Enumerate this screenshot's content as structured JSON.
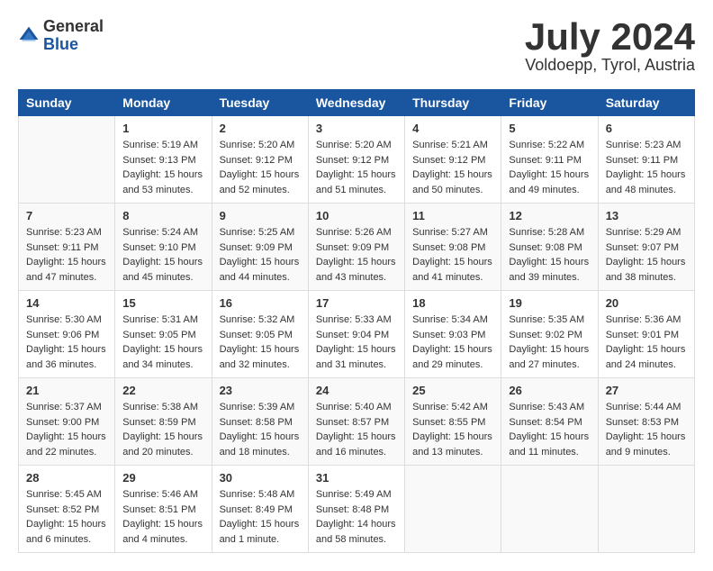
{
  "header": {
    "logo_general": "General",
    "logo_blue": "Blue",
    "month_title": "July 2024",
    "location": "Voldoepp, Tyrol, Austria"
  },
  "columns": [
    "Sunday",
    "Monday",
    "Tuesday",
    "Wednesday",
    "Thursday",
    "Friday",
    "Saturday"
  ],
  "weeks": [
    [
      {
        "day": "",
        "detail": ""
      },
      {
        "day": "1",
        "detail": "Sunrise: 5:19 AM\nSunset: 9:13 PM\nDaylight: 15 hours\nand 53 minutes."
      },
      {
        "day": "2",
        "detail": "Sunrise: 5:20 AM\nSunset: 9:12 PM\nDaylight: 15 hours\nand 52 minutes."
      },
      {
        "day": "3",
        "detail": "Sunrise: 5:20 AM\nSunset: 9:12 PM\nDaylight: 15 hours\nand 51 minutes."
      },
      {
        "day": "4",
        "detail": "Sunrise: 5:21 AM\nSunset: 9:12 PM\nDaylight: 15 hours\nand 50 minutes."
      },
      {
        "day": "5",
        "detail": "Sunrise: 5:22 AM\nSunset: 9:11 PM\nDaylight: 15 hours\nand 49 minutes."
      },
      {
        "day": "6",
        "detail": "Sunrise: 5:23 AM\nSunset: 9:11 PM\nDaylight: 15 hours\nand 48 minutes."
      }
    ],
    [
      {
        "day": "7",
        "detail": "Sunrise: 5:23 AM\nSunset: 9:11 PM\nDaylight: 15 hours\nand 47 minutes."
      },
      {
        "day": "8",
        "detail": "Sunrise: 5:24 AM\nSunset: 9:10 PM\nDaylight: 15 hours\nand 45 minutes."
      },
      {
        "day": "9",
        "detail": "Sunrise: 5:25 AM\nSunset: 9:09 PM\nDaylight: 15 hours\nand 44 minutes."
      },
      {
        "day": "10",
        "detail": "Sunrise: 5:26 AM\nSunset: 9:09 PM\nDaylight: 15 hours\nand 43 minutes."
      },
      {
        "day": "11",
        "detail": "Sunrise: 5:27 AM\nSunset: 9:08 PM\nDaylight: 15 hours\nand 41 minutes."
      },
      {
        "day": "12",
        "detail": "Sunrise: 5:28 AM\nSunset: 9:08 PM\nDaylight: 15 hours\nand 39 minutes."
      },
      {
        "day": "13",
        "detail": "Sunrise: 5:29 AM\nSunset: 9:07 PM\nDaylight: 15 hours\nand 38 minutes."
      }
    ],
    [
      {
        "day": "14",
        "detail": "Sunrise: 5:30 AM\nSunset: 9:06 PM\nDaylight: 15 hours\nand 36 minutes."
      },
      {
        "day": "15",
        "detail": "Sunrise: 5:31 AM\nSunset: 9:05 PM\nDaylight: 15 hours\nand 34 minutes."
      },
      {
        "day": "16",
        "detail": "Sunrise: 5:32 AM\nSunset: 9:05 PM\nDaylight: 15 hours\nand 32 minutes."
      },
      {
        "day": "17",
        "detail": "Sunrise: 5:33 AM\nSunset: 9:04 PM\nDaylight: 15 hours\nand 31 minutes."
      },
      {
        "day": "18",
        "detail": "Sunrise: 5:34 AM\nSunset: 9:03 PM\nDaylight: 15 hours\nand 29 minutes."
      },
      {
        "day": "19",
        "detail": "Sunrise: 5:35 AM\nSunset: 9:02 PM\nDaylight: 15 hours\nand 27 minutes."
      },
      {
        "day": "20",
        "detail": "Sunrise: 5:36 AM\nSunset: 9:01 PM\nDaylight: 15 hours\nand 24 minutes."
      }
    ],
    [
      {
        "day": "21",
        "detail": "Sunrise: 5:37 AM\nSunset: 9:00 PM\nDaylight: 15 hours\nand 22 minutes."
      },
      {
        "day": "22",
        "detail": "Sunrise: 5:38 AM\nSunset: 8:59 PM\nDaylight: 15 hours\nand 20 minutes."
      },
      {
        "day": "23",
        "detail": "Sunrise: 5:39 AM\nSunset: 8:58 PM\nDaylight: 15 hours\nand 18 minutes."
      },
      {
        "day": "24",
        "detail": "Sunrise: 5:40 AM\nSunset: 8:57 PM\nDaylight: 15 hours\nand 16 minutes."
      },
      {
        "day": "25",
        "detail": "Sunrise: 5:42 AM\nSunset: 8:55 PM\nDaylight: 15 hours\nand 13 minutes."
      },
      {
        "day": "26",
        "detail": "Sunrise: 5:43 AM\nSunset: 8:54 PM\nDaylight: 15 hours\nand 11 minutes."
      },
      {
        "day": "27",
        "detail": "Sunrise: 5:44 AM\nSunset: 8:53 PM\nDaylight: 15 hours\nand 9 minutes."
      }
    ],
    [
      {
        "day": "28",
        "detail": "Sunrise: 5:45 AM\nSunset: 8:52 PM\nDaylight: 15 hours\nand 6 minutes."
      },
      {
        "day": "29",
        "detail": "Sunrise: 5:46 AM\nSunset: 8:51 PM\nDaylight: 15 hours\nand 4 minutes."
      },
      {
        "day": "30",
        "detail": "Sunrise: 5:48 AM\nSunset: 8:49 PM\nDaylight: 15 hours\nand 1 minute."
      },
      {
        "day": "31",
        "detail": "Sunrise: 5:49 AM\nSunset: 8:48 PM\nDaylight: 14 hours\nand 58 minutes."
      },
      {
        "day": "",
        "detail": ""
      },
      {
        "day": "",
        "detail": ""
      },
      {
        "day": "",
        "detail": ""
      }
    ]
  ]
}
